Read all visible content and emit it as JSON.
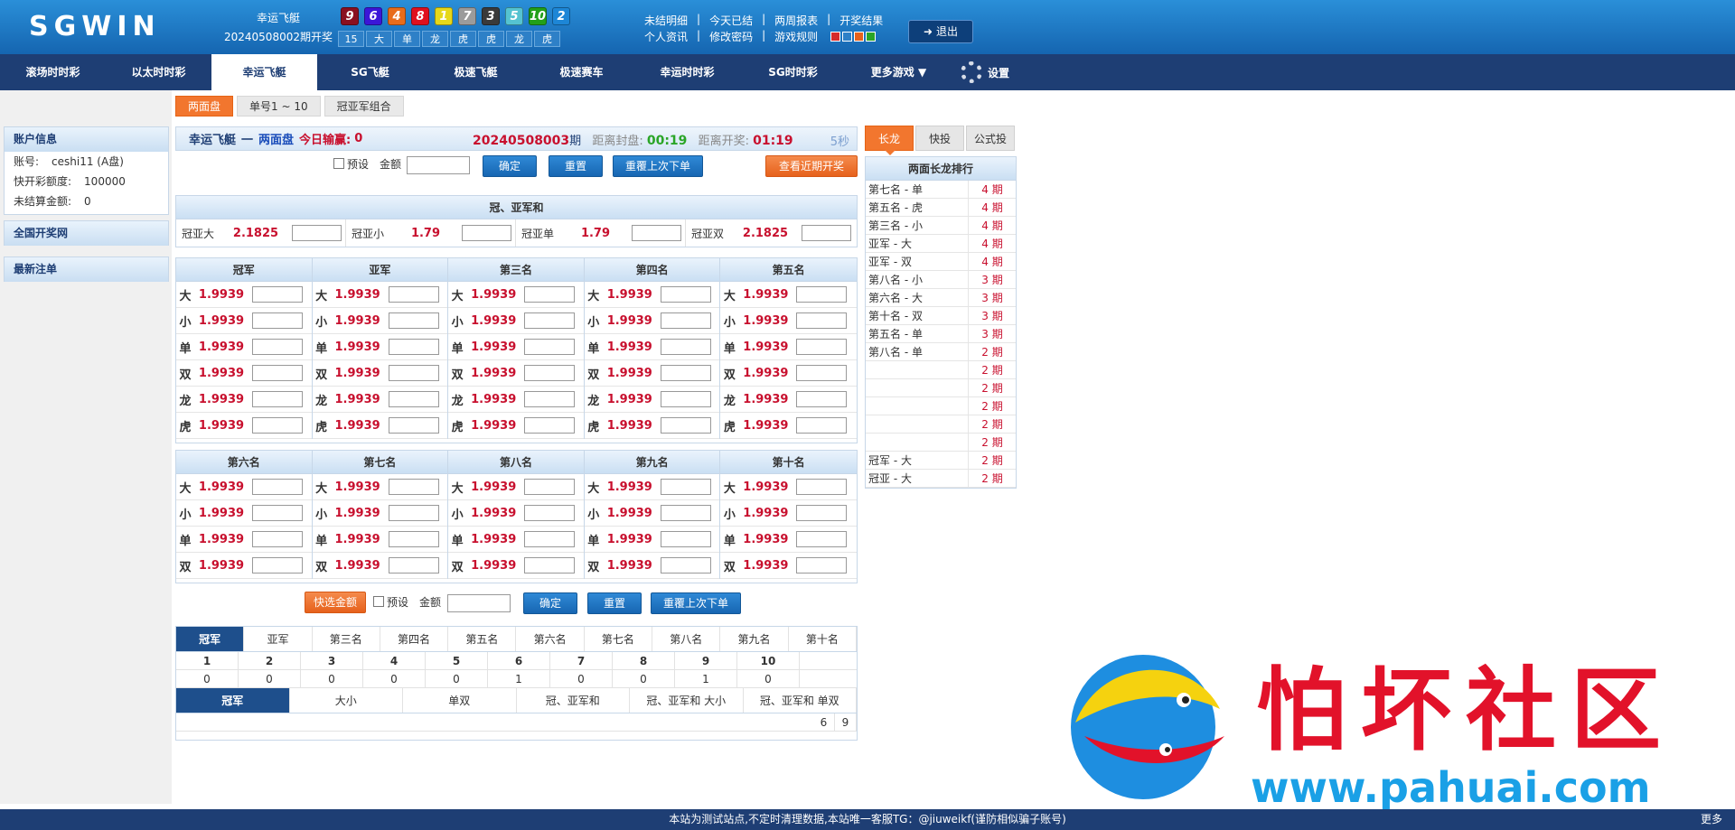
{
  "header": {
    "logo": "SGWIN",
    "game_name": "幸运飞艇",
    "draw_label": "20240508002期开奖",
    "balls": [
      {
        "n": "9",
        "color": "#8a1020"
      },
      {
        "n": "6",
        "color": "#3b16d8"
      },
      {
        "n": "4",
        "color": "#e86c1a"
      },
      {
        "n": "8",
        "color": "#e0101e"
      },
      {
        "n": "1",
        "color": "#e6d819"
      },
      {
        "n": "7",
        "color": "#9b9b9b"
      },
      {
        "n": "3",
        "color": "#3a3a3a"
      },
      {
        "n": "5",
        "color": "#55c3d1"
      },
      {
        "n": "10",
        "color": "#22a019"
      },
      {
        "n": "2",
        "color": "#1d86d6"
      }
    ],
    "stats": [
      "15",
      "大",
      "单",
      "龙",
      "虎",
      "虎",
      "龙",
      "虎"
    ],
    "links_row1": [
      "未结明细",
      "今天已结",
      "两周报表",
      "开奖结果"
    ],
    "links_row2": [
      "个人资讯",
      "修改密码",
      "游戏规则"
    ],
    "swatches": [
      "#d62b2b",
      "#2e80c7",
      "#e6611c",
      "#2aa527"
    ],
    "logout_label": "退出"
  },
  "nav": {
    "tabs": [
      "滚场时时彩",
      "以太时时彩",
      "幸运飞艇",
      "SG飞艇",
      "极速飞艇",
      "极速赛车",
      "幸运时时彩",
      "SG时时彩",
      "更多游戏 ▼"
    ],
    "active": 2,
    "settings_label": "设置"
  },
  "left": {
    "account_title": "账户信息",
    "account_lines": [
      [
        "账号:",
        "ceshi11 (A盘)"
      ],
      [
        "快开彩额度:",
        "100000"
      ],
      [
        "未结算金额:",
        "0"
      ]
    ],
    "section2": "全国开奖网",
    "section3": "最新注单"
  },
  "subtabs": [
    "两面盘",
    "单号1 ~ 10",
    "冠亚军组合"
  ],
  "infobar": {
    "game": "幸运飞艇",
    "dash": "一",
    "mode": "两面盘",
    "profit_label": "今日输赢:",
    "profit": "0",
    "period": "20240508003",
    "period_suffix": "期",
    "close_label": "距离封盘:",
    "close_time": "00:19",
    "open_label": "距离开奖:",
    "open_time": "01:19",
    "refresh": "5秒"
  },
  "controls": {
    "preset": "预设",
    "amount": "金额",
    "confirm": "确定",
    "reset": "重置",
    "repeat": "重覆上次下单",
    "recent": "查看近期开奖",
    "quick": "快选金额"
  },
  "lead": {
    "title": "冠、亚军和",
    "items": [
      [
        "冠亚大",
        "2.1825"
      ],
      [
        "冠亚小",
        "1.79"
      ],
      [
        "冠亚单",
        "1.79"
      ],
      [
        "冠亚双",
        "2.1825"
      ]
    ]
  },
  "top_positions": {
    "names": [
      "冠军",
      "亚军",
      "第三名",
      "第四名",
      "第五名"
    ],
    "labels": [
      "大",
      "小",
      "单",
      "双",
      "龙",
      "虎"
    ],
    "odds": "1.9939"
  },
  "bottom_positions": {
    "names": [
      "第六名",
      "第七名",
      "第八名",
      "第九名",
      "第十名"
    ],
    "labels": [
      "大",
      "小",
      "单",
      "双"
    ],
    "odds": "1.9939"
  },
  "stats_table": {
    "tabs": [
      "冠军",
      "亚军",
      "第三名",
      "第四名",
      "第五名",
      "第六名",
      "第七名",
      "第八名",
      "第九名",
      "第十名"
    ],
    "numbers": [
      "1",
      "2",
      "3",
      "4",
      "5",
      "6",
      "7",
      "8",
      "9",
      "10"
    ],
    "counts": [
      "0",
      "0",
      "0",
      "0",
      "0",
      "1",
      "0",
      "0",
      "1",
      "0"
    ],
    "tabs2": [
      "冠军",
      "大小",
      "单双",
      "冠、亚军和",
      "冠、亚军和 大小",
      "冠、亚军和 单双"
    ],
    "tail": [
      "6",
      "9"
    ]
  },
  "right": {
    "tabs": [
      "长龙",
      "快投",
      "公式投"
    ],
    "title": "两面长龙排行",
    "rows": [
      [
        "第七名 - 单",
        "4 期"
      ],
      [
        "第五名 - 虎",
        "4 期"
      ],
      [
        "第三名 - 小",
        "4 期"
      ],
      [
        "亚军 - 大",
        "4 期"
      ],
      [
        "亚军 - 双",
        "4 期"
      ],
      [
        "第八名 - 小",
        "3 期"
      ],
      [
        "第六名 - 大",
        "3 期"
      ],
      [
        "第十名 - 双",
        "3 期"
      ],
      [
        "第五名 - 单",
        "3 期"
      ],
      [
        "第八名 - 单",
        "2 期"
      ],
      [
        "",
        "2 期"
      ],
      [
        "",
        "2 期"
      ],
      [
        "",
        "2 期"
      ],
      [
        "",
        "2 期"
      ],
      [
        "",
        "2 期"
      ],
      [
        "冠军 - 大",
        "2 期"
      ],
      [
        "冠亚 - 大",
        "2 期"
      ]
    ]
  },
  "footer": {
    "text": "本站为测试站点,不定时清理数据,本站唯一客服TG：@jiuweikf(谨防相似骗子账号)",
    "more": "更多"
  },
  "watermark": {
    "text": "怕坏社区",
    "url": "www.pahuai.com"
  }
}
